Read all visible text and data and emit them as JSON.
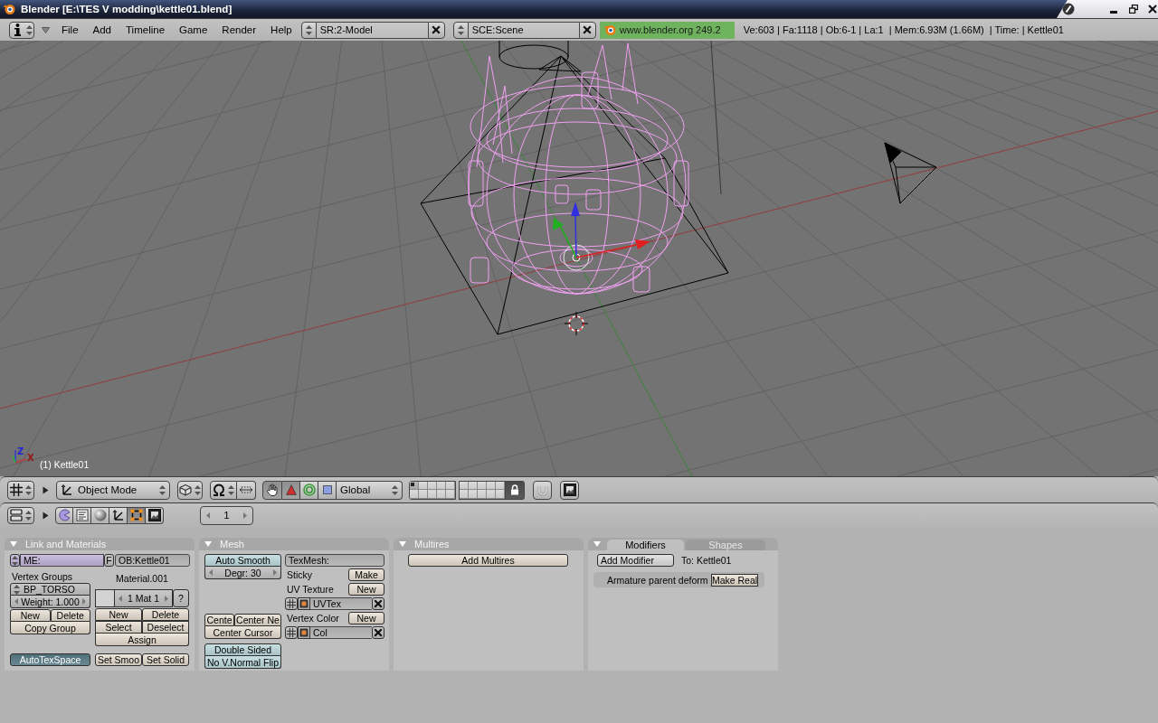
{
  "window": {
    "title": "Blender [E:\\TES V modding\\kettle01.blend]"
  },
  "info_header": {
    "menus_expanded": true,
    "menus": [
      "File",
      "Add",
      "Timeline",
      "Game",
      "Render",
      "Help"
    ],
    "screen": "SR:2-Model",
    "scene": "SCE:Scene",
    "version": "www.blender.org 249.2",
    "stats": "Ve:603 | Fa:1118 | Ob:6-1 | La:1  | Mem:6.93M (1.66M)  | Time: | Kettle01"
  },
  "viewport": {
    "axis_labels": [
      {
        "text": "Z",
        "color": "#2424d8"
      },
      {
        "text": "X",
        "color": "#941818"
      }
    ],
    "active_object": "(1) Kettle01"
  },
  "view_header": {
    "menus_expanded": false,
    "mode": "Object Mode",
    "manipulator_on": true,
    "transforms": [
      {
        "kind": "translate",
        "on": true
      },
      {
        "kind": "rotate",
        "on": false
      },
      {
        "kind": "scale",
        "on": false
      }
    ],
    "orientation": "Global",
    "layers": [
      {
        "on": true
      },
      {
        "on": false
      },
      {
        "on": false
      },
      {
        "on": false
      },
      {
        "on": false
      },
      {
        "on": false
      },
      {
        "on": false
      },
      {
        "on": false
      },
      {
        "on": false
      },
      {
        "on": false
      },
      {
        "on": false
      },
      {
        "on": false
      },
      {
        "on": false
      },
      {
        "on": false
      },
      {
        "on": false
      },
      {
        "on": false
      },
      {
        "on": false
      },
      {
        "on": false
      },
      {
        "on": false
      },
      {
        "on": false
      }
    ],
    "lock_on": true,
    "snap_on": false
  },
  "buttons_header": {
    "menus_expanded": false,
    "contexts": [
      {
        "kind": "logic",
        "selected": false
      },
      {
        "kind": "script",
        "selected": false
      },
      {
        "kind": "shading",
        "selected": false
      },
      {
        "kind": "object",
        "selected": false
      },
      {
        "kind": "editing",
        "selected": true
      },
      {
        "kind": "scene",
        "selected": false
      }
    ],
    "frame": "1"
  },
  "link_and_materials": {
    "expanded": true,
    "title": "Link and Materials",
    "mesh_name": "ME:",
    "fake_user": "F",
    "object_name": "OB:Kettle01",
    "vertex_groups_label": "Vertex Groups",
    "vertex_group": "BP_TORSO",
    "weight": "Weight: 1.000",
    "group_buttons": [
      "New",
      "Delete",
      "Copy Group"
    ],
    "material_name": "Material.001",
    "material_index": "1 Mat 1",
    "material_help": "?",
    "material_buttons": [
      "New",
      "Delete",
      "Select",
      "Deselect",
      "Assign"
    ],
    "auto_tex_space": {
      "label": "AutoTexSpace",
      "on": true
    },
    "smooth_buttons": [
      "Set Smoo",
      "Set Solid"
    ]
  },
  "mesh": {
    "expanded": true,
    "title": "Mesh",
    "auto_smooth": {
      "label": "Auto Smooth",
      "on": false
    },
    "degree": "Degr: 30",
    "tex_mesh": "TexMesh:",
    "sticky": {
      "label": "Sticky",
      "button": "Make"
    },
    "uv_texture": {
      "label": "UV Texture",
      "button": "New",
      "layer": "UVTex"
    },
    "center_buttons": [
      "Cente",
      "Center Ne",
      "Center Cursor"
    ],
    "vertex_color": {
      "label": "Vertex Color",
      "button": "New",
      "layer": "Col"
    },
    "toggles": [
      {
        "label": "Double Sided",
        "on": false
      },
      {
        "label": "No V.Normal Flip",
        "on": false
      }
    ]
  },
  "multires": {
    "expanded": true,
    "title": "Multires",
    "button": "Add Multires"
  },
  "modifiers": {
    "expanded": true,
    "tabs": [
      {
        "label": "Modifiers",
        "selected": true
      },
      {
        "label": "Shapes",
        "selected": false
      }
    ],
    "add_button": "Add Modifier",
    "target": "To: Kettle01",
    "items": [
      {
        "label": "Armature parent deform",
        "button": "Make Real"
      }
    ]
  }
}
